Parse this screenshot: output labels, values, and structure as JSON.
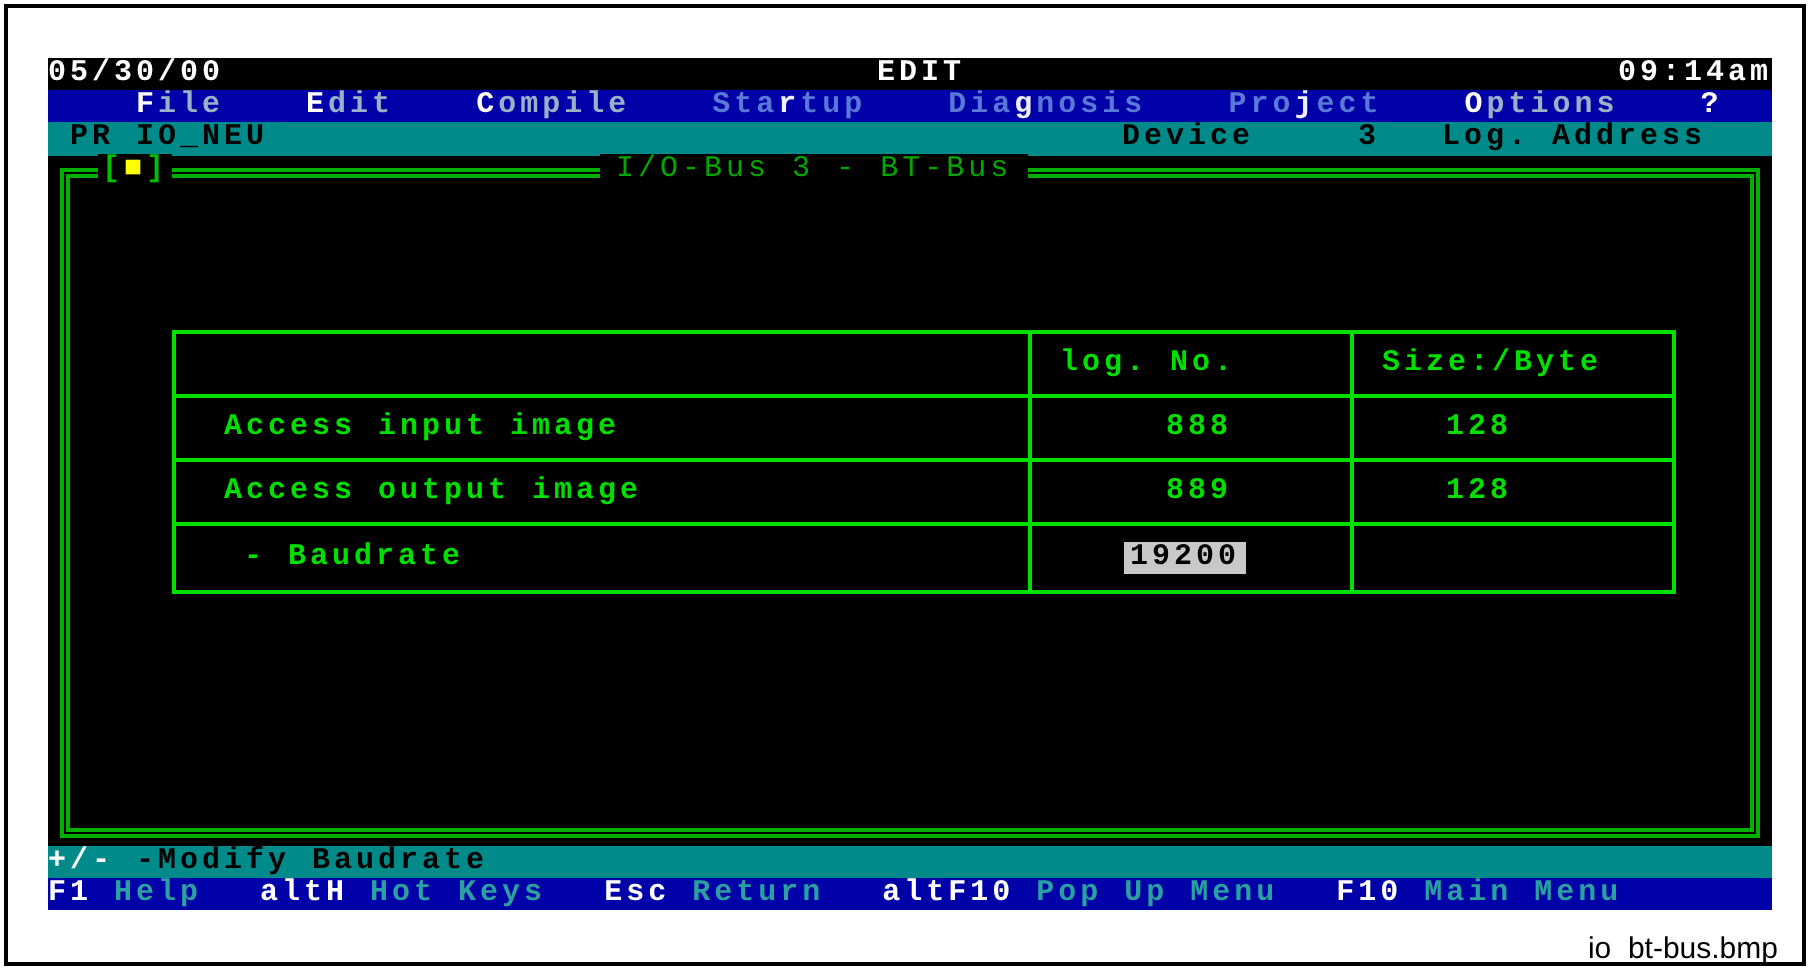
{
  "header": {
    "date": "05/30/00",
    "mode": "EDIT",
    "time": "09:14am"
  },
  "menu": [
    {
      "hotkey": "F",
      "after": "ile",
      "disabled": false
    },
    {
      "hotkey": "E",
      "after": "dit",
      "disabled": false
    },
    {
      "hotkey": "C",
      "after": "ompile",
      "disabled": false
    },
    {
      "before": "Sta",
      "hotkey": "r",
      "after": "tup",
      "disabled": true
    },
    {
      "before": "Dia",
      "hotkey": "g",
      "after": "nosis",
      "disabled": true
    },
    {
      "before": "Pro",
      "hotkey": "j",
      "after": "ect",
      "disabled": true
    },
    {
      "hotkey": "O",
      "after": "ptions",
      "disabled": false
    },
    {
      "hotkey": "?",
      "disabled": false
    }
  ],
  "info_bar": {
    "project": "PR IO_NEU",
    "device_label": "Device",
    "device": "3",
    "address_label": "Log. Address"
  },
  "panel": {
    "window_control": "[■]",
    "title": "I/O-Bus 3 - BT-Bus",
    "table": {
      "columns": [
        {
          "label": "log. No."
        },
        {
          "label": "Size:/Byte"
        }
      ],
      "rows": [
        {
          "kind": "item",
          "name": "Access input image",
          "log_no": "888",
          "size": "128"
        },
        {
          "kind": "item",
          "name": "Access output image",
          "log_no": "889",
          "size": "128"
        },
        {
          "kind": "parameter",
          "name": "- Baudrate",
          "log_no": "19200"
        }
      ]
    }
  },
  "hint_bar": {
    "key": "+/-",
    "text": "-Modify Baudrate"
  },
  "function_keys": [
    {
      "key": "F1",
      "label": "Help"
    },
    {
      "key": "altH",
      "label": "Hot Keys"
    },
    {
      "key": "Esc",
      "label": "Return"
    },
    {
      "key": "altF10",
      "label": "Pop Up Menu"
    },
    {
      "key": "F10",
      "label": "Main Menu"
    }
  ],
  "caption": "io_bt-bus.bmp"
}
